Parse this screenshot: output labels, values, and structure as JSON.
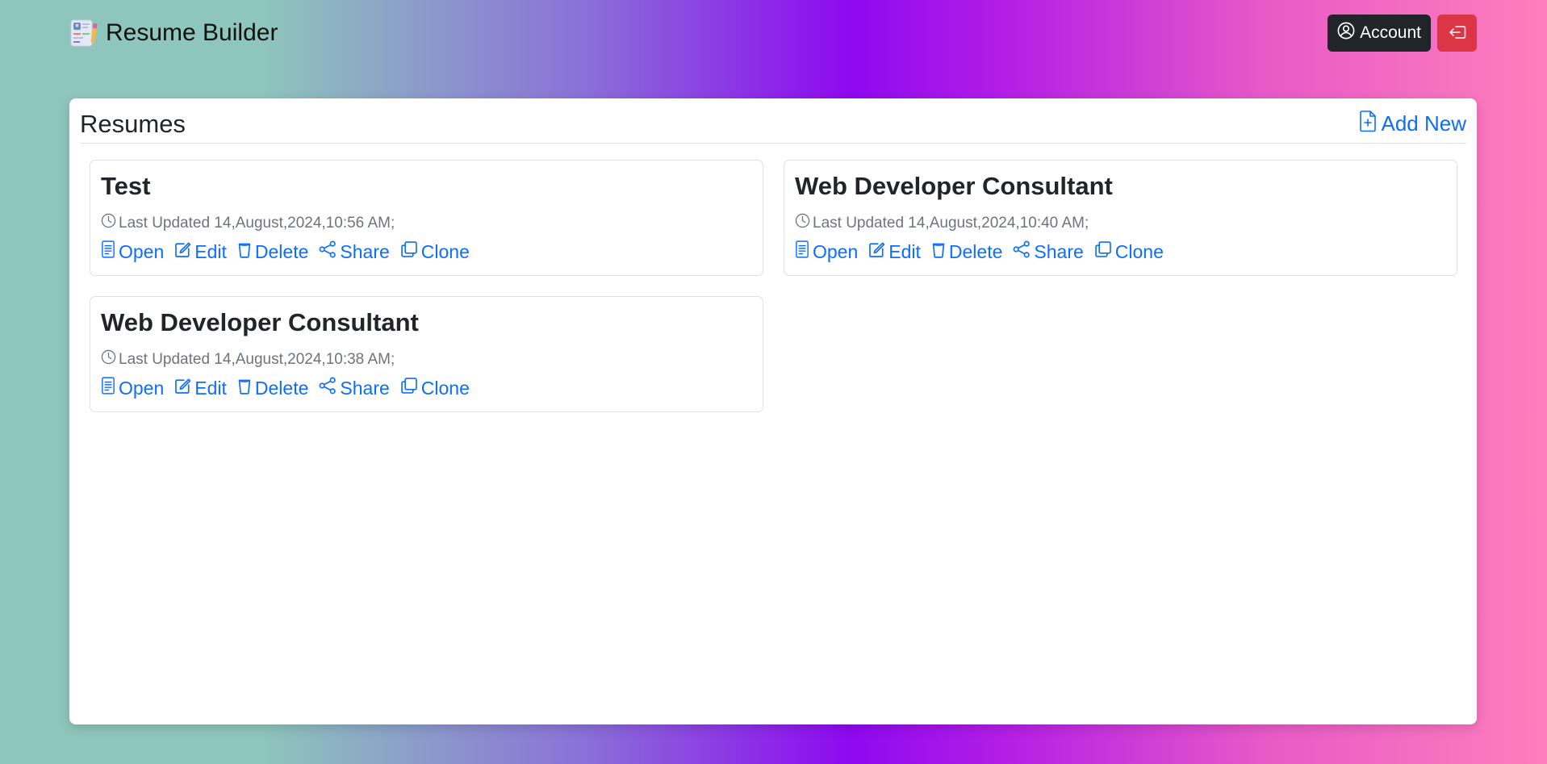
{
  "navbar": {
    "brand_title": "Resume Builder",
    "account_label": "Account",
    "logout_icon": "box-arrow-left-icon"
  },
  "panel": {
    "title": "Resumes",
    "add_new_label": "Add New"
  },
  "resumes": [
    {
      "title": "Test",
      "updated": "Last Updated 14,August,2024,10:56 AM;"
    },
    {
      "title": "Web Developer Consultant",
      "updated": "Last Updated 14,August,2024,10:40 AM;"
    },
    {
      "title": "Web Developer Consultant",
      "updated": "Last Updated 14,August,2024,10:38 AM;"
    }
  ],
  "actions": {
    "open": "Open",
    "edit": "Edit",
    "delete": "Delete",
    "share": "Share",
    "clone": "Clone"
  },
  "colors": {
    "link": "#0d6efd",
    "account_button": "#212529",
    "logout_button": "#dc3545"
  }
}
